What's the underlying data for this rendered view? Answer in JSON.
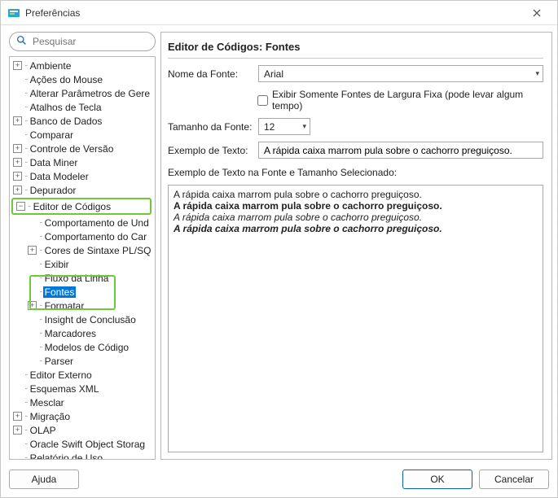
{
  "window": {
    "title": "Preferências"
  },
  "search": {
    "placeholder": "Pesquisar"
  },
  "tree": [
    {
      "label": "Ambiente",
      "exp": "plus",
      "indent": 1
    },
    {
      "label": "Ações do Mouse",
      "exp": "dot",
      "indent": 1
    },
    {
      "label": "Alterar Parâmetros de Gere",
      "exp": "dot",
      "indent": 1
    },
    {
      "label": "Atalhos de Tecla",
      "exp": "dot",
      "indent": 1
    },
    {
      "label": "Banco de Dados",
      "exp": "plus",
      "indent": 1
    },
    {
      "label": "Comparar",
      "exp": "dot",
      "indent": 1
    },
    {
      "label": "Controle de Versão",
      "exp": "plus",
      "indent": 1
    },
    {
      "label": "Data Miner",
      "exp": "plus",
      "indent": 1
    },
    {
      "label": "Data Modeler",
      "exp": "plus",
      "indent": 1
    },
    {
      "label": "Depurador",
      "exp": "plus",
      "indent": 1
    },
    {
      "label": "Editor de Códigos",
      "exp": "minus",
      "indent": 1,
      "greenbox": true
    },
    {
      "label": "Comportamento de Und",
      "exp": "dot",
      "indent": 2
    },
    {
      "label": "Comportamento do Car",
      "exp": "dot",
      "indent": 2
    },
    {
      "label": "Cores de Sintaxe PL/SQ",
      "exp": "plus",
      "indent": 2
    },
    {
      "label": "Exibir",
      "exp": "dot",
      "indent": 2
    },
    {
      "label": "Fluxo da Linha",
      "exp": "dot",
      "indent": 2,
      "greencut": "top"
    },
    {
      "label": "Fontes",
      "exp": "dot",
      "indent": 2,
      "selected": true,
      "greenbox2": true
    },
    {
      "label": "Formatar",
      "exp": "plus",
      "indent": 2,
      "greencut": "bot"
    },
    {
      "label": "Insight de Conclusão",
      "exp": "dot",
      "indent": 2
    },
    {
      "label": "Marcadores",
      "exp": "dot",
      "indent": 2
    },
    {
      "label": "Modelos de Código",
      "exp": "dot",
      "indent": 2
    },
    {
      "label": "Parser",
      "exp": "dot",
      "indent": 2
    },
    {
      "label": "Editor Externo",
      "exp": "dot",
      "indent": 1
    },
    {
      "label": "Esquemas XML",
      "exp": "dot",
      "indent": 1
    },
    {
      "label": "Mesclar",
      "exp": "dot",
      "indent": 1
    },
    {
      "label": "Migração",
      "exp": "plus",
      "indent": 1
    },
    {
      "label": "OLAP",
      "exp": "plus",
      "indent": 1
    },
    {
      "label": "Oracle Swift Object Storag",
      "exp": "dot",
      "indent": 1
    },
    {
      "label": "Relatório de Uso",
      "exp": "dot",
      "indent": 1
    }
  ],
  "panel": {
    "title": "Editor de Códigos: Fontes",
    "fontNameLabel": "Nome da Fonte:",
    "fontNameValue": "Arial",
    "fixedWidthLabel": "Exibir Somente Fontes de Largura Fixa (pode levar algum tempo)",
    "fontSizeLabel": "Tamanho da Fonte:",
    "fontSizeValue": "12",
    "sampleLabel": "Exemplo de Texto:",
    "sampleValue": "A rápida caixa marrom pula sobre o cachorro preguiçoso.",
    "previewLabel": "Exemplo de Texto na Fonte e Tamanho Selecionado:",
    "previewLines": [
      "A rápida caixa marrom pula sobre o cachorro preguiçoso.",
      "A rápida caixa marrom pula sobre o cachorro preguiçoso.",
      "A rápida caixa marrom pula sobre o cachorro preguiçoso.",
      "A rápida caixa marrom pula sobre o cachorro preguiçoso."
    ]
  },
  "buttons": {
    "help": "Ajuda",
    "ok": "OK",
    "cancel": "Cancelar"
  }
}
